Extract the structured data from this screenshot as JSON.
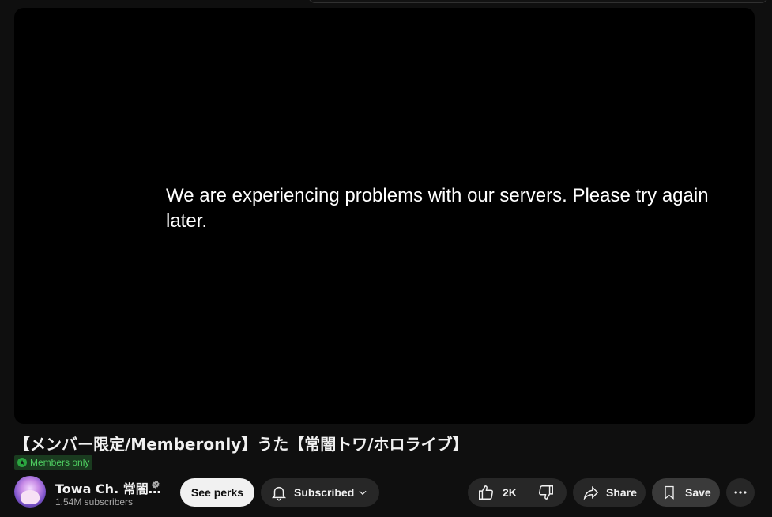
{
  "player": {
    "error_message": "We are experiencing problems with our servers. Please try again later."
  },
  "video": {
    "title": "【メンバー限定/Memberonly】うた【常闇トワ/ホロライブ】",
    "badge_label": "Members only"
  },
  "channel": {
    "name": "Towa Ch. 常闇…",
    "subscribers": "1.54M subscribers"
  },
  "actions": {
    "perks_label": "See perks",
    "subscribed_label": "Subscribed",
    "like_count": "2K",
    "share_label": "Share",
    "save_label": "Save"
  },
  "colors": {
    "background": "#0f0f0f",
    "player": "#000000",
    "button_bg": "#272727",
    "members_green": "#2ba640"
  },
  "icons": [
    "verified-icon",
    "bell-icon",
    "chevron-down-icon",
    "thumbs-up-icon",
    "thumbs-down-icon",
    "share-icon",
    "bookmark-icon",
    "more-icon",
    "star-icon"
  ]
}
